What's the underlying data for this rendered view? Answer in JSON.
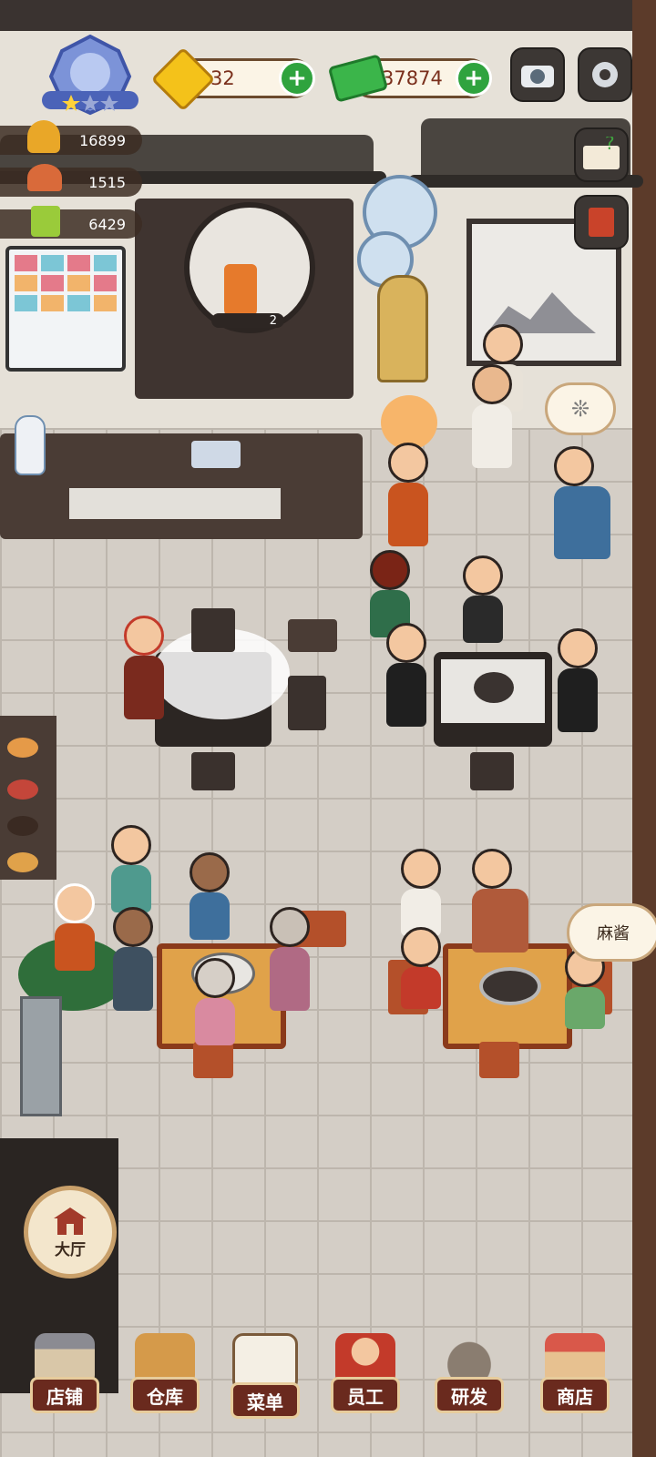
{
  "hud": {
    "gems": "32",
    "cash": "37874",
    "stats": [
      {
        "icon": "hotpot-icon",
        "value": "16899"
      },
      {
        "icon": "serving-cloche-icon",
        "value": "1515"
      },
      {
        "icon": "ticket-icon",
        "value": "6429"
      }
    ],
    "rank_stars": 1
  },
  "scene": {
    "drink_counter_badge": "2",
    "speech_bubble_text": "麻酱",
    "fish_bubble_icon": "fish-icon"
  },
  "hall_button": {
    "label": "大厅"
  },
  "nav": [
    {
      "label": "店铺",
      "icon": "shop-front-icon"
    },
    {
      "label": "仓库",
      "icon": "boxes-icon"
    },
    {
      "label": "菜单",
      "icon": "clipboard-menu-icon"
    },
    {
      "label": "员工",
      "icon": "staff-icon"
    },
    {
      "label": "研发",
      "icon": "wok-icon"
    },
    {
      "label": "商店",
      "icon": "store-icon"
    }
  ],
  "colors": {
    "accent": "#6a2a1e",
    "plus": "#2fa33e",
    "gem": "#f4c21a"
  }
}
